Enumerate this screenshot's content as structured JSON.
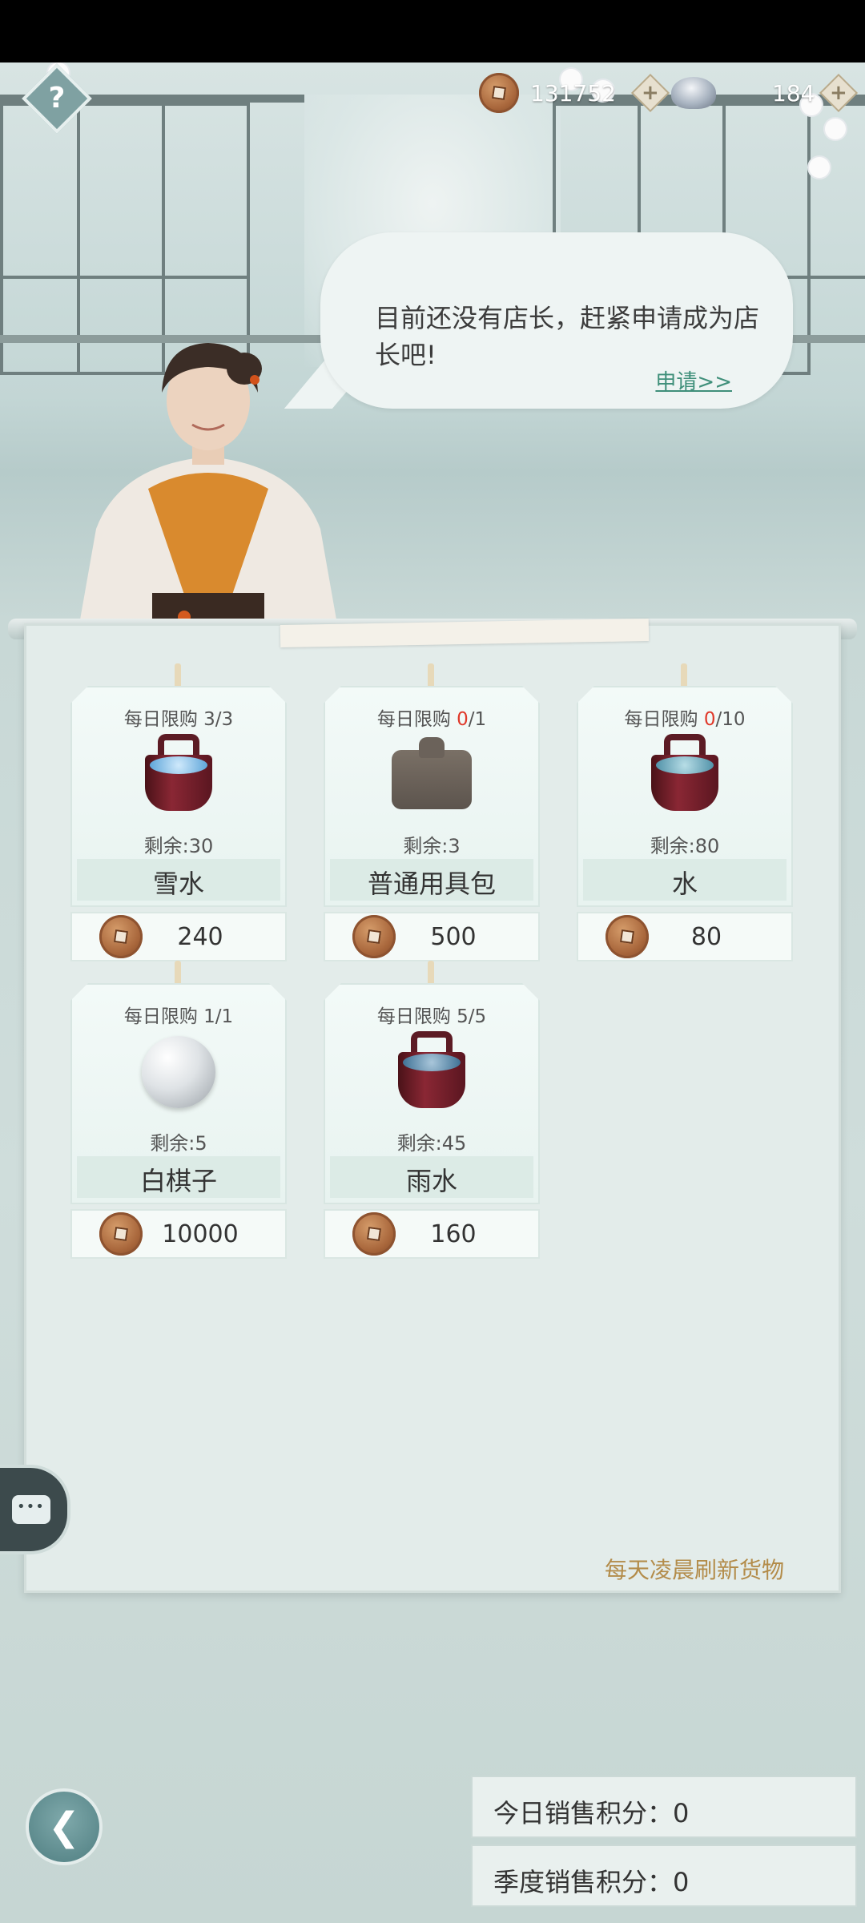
{
  "currency": {
    "copper_amount": "131752",
    "silver_amount": "184",
    "plus_symbol": "+"
  },
  "help": {
    "symbol": "?"
  },
  "bubble": {
    "message": "目前还没有店长，赶紧申请成为店长吧!",
    "apply_link": "申请>>"
  },
  "shop": {
    "items": [
      {
        "limit_label": "每日限购",
        "limit_current": "3",
        "limit_max": "/3",
        "limit_current_red": false,
        "remaining": "剩余:30",
        "name": "雪水",
        "price": "240",
        "icon": "snow-water-bucket-icon"
      },
      {
        "limit_label": "每日限购",
        "limit_current": "0",
        "limit_max": "/1",
        "limit_current_red": true,
        "remaining": "剩余:3",
        "name": "普通用具包",
        "price": "500",
        "icon": "tool-bundle-icon"
      },
      {
        "limit_label": "每日限购",
        "limit_current": "0",
        "limit_max": "/10",
        "limit_current_red": true,
        "remaining": "剩余:80",
        "name": "水",
        "price": "80",
        "icon": "water-bucket-icon"
      },
      {
        "limit_label": "每日限购",
        "limit_current": "1",
        "limit_max": "/1",
        "limit_current_red": false,
        "remaining": "剩余:5",
        "name": "白棋子",
        "price": "10000",
        "icon": "white-go-stone-icon"
      },
      {
        "limit_label": "每日限购",
        "limit_current": "5",
        "limit_max": "/5",
        "limit_current_red": false,
        "remaining": "剩余:45",
        "name": "雨水",
        "price": "160",
        "icon": "rain-water-bucket-icon"
      }
    ],
    "refresh_note": "每天凌晨刷新货物"
  },
  "scores": {
    "today": "今日销售积分：0",
    "season": "季度销售积分：0"
  },
  "colors": {
    "accent_green": "#3f8f7a",
    "limit_red": "#e0392a",
    "note_gold": "#b38c4a"
  }
}
